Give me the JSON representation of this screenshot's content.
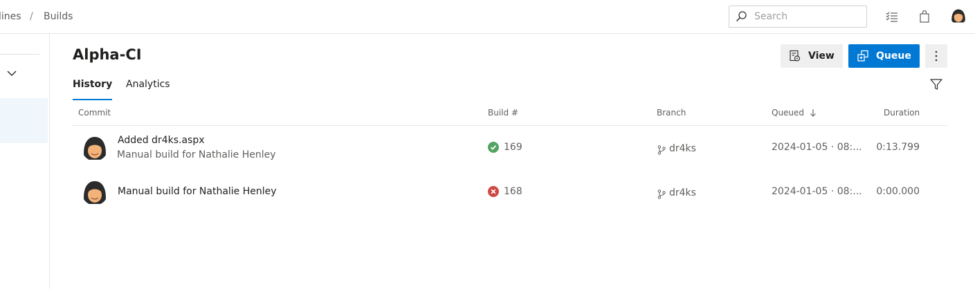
{
  "breadcrumb": {
    "part1": "lines",
    "separator": "/",
    "part2": "Builds"
  },
  "search": {
    "placeholder": "Search",
    "value": ""
  },
  "page": {
    "title": "Alpha-CI"
  },
  "actions": {
    "view_label": "View",
    "queue_label": "Queue"
  },
  "tabs": [
    {
      "label": "History",
      "selected": true
    },
    {
      "label": "Analytics",
      "selected": false
    }
  ],
  "table": {
    "headers": {
      "commit": "Commit",
      "build": "Build #",
      "branch": "Branch",
      "queued": "Queued",
      "duration": "Duration"
    },
    "rows": [
      {
        "title": "Added dr4ks.aspx",
        "subtitle": "Manual build for Nathalie Henley",
        "status": "succeeded",
        "build_number": "169",
        "branch": "dr4ks",
        "queued": "2024-01-05 · 08:...",
        "duration": "0:13.799"
      },
      {
        "title": "Manual build for Nathalie Henley",
        "subtitle": "",
        "status": "failed",
        "build_number": "168",
        "branch": "dr4ks",
        "queued": "2024-01-05 · 08:...",
        "duration": "0:00.000"
      }
    ]
  },
  "colors": {
    "accent": "#0078d4",
    "success": "#55a362",
    "failed": "#cd4a45",
    "selected_nav": "#eff6fc"
  },
  "icons": {
    "search": "search-icon",
    "list": "list-icon",
    "bag": "shopping-bag-icon",
    "view": "view-icon",
    "queue": "queue-icon",
    "more": "more-vertical-icon",
    "filter": "filter-icon",
    "branch": "branch-icon",
    "sort": "sort-down-arrow-icon"
  }
}
